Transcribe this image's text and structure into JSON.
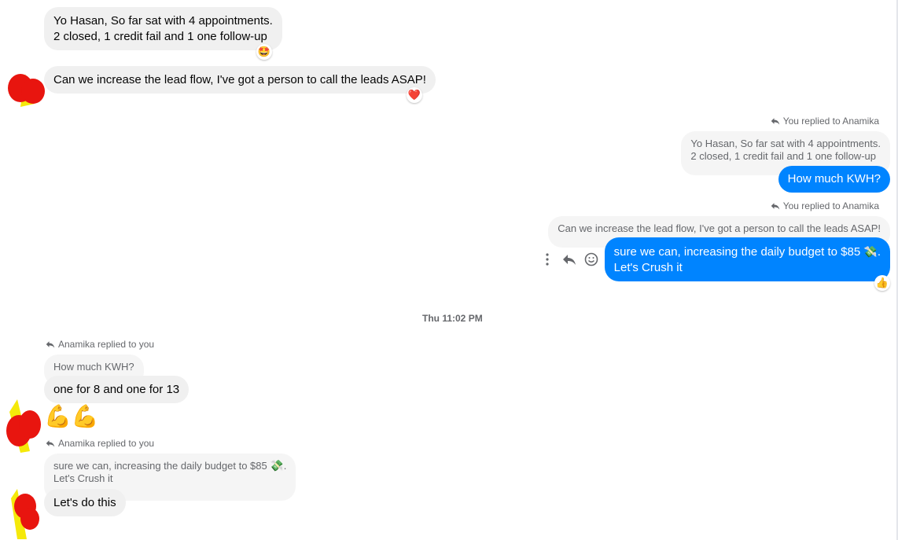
{
  "messages": {
    "m1": {
      "line1": "Yo Hasan, So far sat with 4 appointments.",
      "line2": "2 closed, 1 credit fail and 1 one follow-up",
      "reaction": "🤩"
    },
    "m2": {
      "text": "Can we increase the lead flow, I've got a person to call the leads ASAP!",
      "reaction": "❤️"
    },
    "r1": {
      "note": "You replied to Anamika",
      "quote_line1": "Yo Hasan, So far sat with 4 appointments.",
      "quote_line2": "2 closed, 1 credit fail and 1 one follow-up",
      "text": "How much KWH?"
    },
    "r2": {
      "note": "You replied to Anamika",
      "quote": "Can we increase the lead flow, I've got a person to call the leads ASAP!",
      "line1": "sure we can, increasing the daily budget to $85",
      "line1_emoji": "💸",
      "line1_end": ".",
      "line2": "Let's Crush it",
      "reaction": "👍"
    },
    "timestamp": "Thu 11:02 PM",
    "r3": {
      "note": "Anamika replied to you",
      "quote": "How much KWH?",
      "text": "one for 8 and one for 13",
      "emoji": "💪💪"
    },
    "r4": {
      "note": "Anamika replied to you",
      "quote_line1": "sure we can, increasing the daily budget to $85",
      "quote_emoji": "💸",
      "quote_end": ".",
      "quote_line2": "Let's Crush it",
      "text": "Let's do this"
    }
  },
  "icons": {
    "more": "more-vertical-icon",
    "reply": "reply-icon",
    "react": "smiley-icon"
  },
  "colors": {
    "sent_bubble": "#0084ff",
    "received_bubble": "#f0f0f0",
    "quote_bubble": "#f5f5f5",
    "meta_text": "#65676b"
  }
}
